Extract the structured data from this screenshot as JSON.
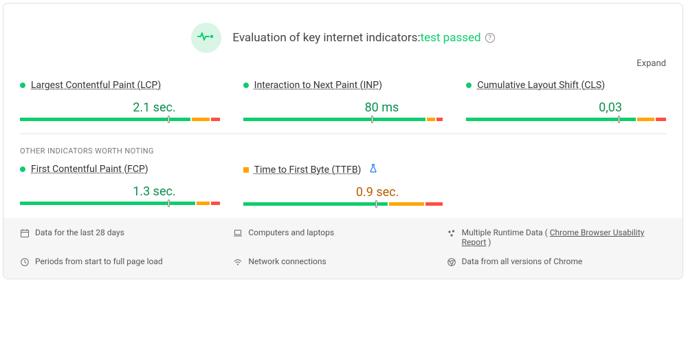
{
  "header": {
    "title_prefix": "Evaluation of key internet indicators:",
    "status_text": "test passed",
    "help_tooltip": "?"
  },
  "controls": {
    "expand_label": "Expand"
  },
  "metrics": {
    "primary": [
      {
        "name": "Largest Contentful Paint (LCP)",
        "value": "2.1 sec.",
        "status": "green",
        "segments": {
          "green": 76,
          "orange": 8,
          "red": 4
        },
        "marker_percent": 74
      },
      {
        "name": "Interaction to Next Paint (INP)",
        "value": "80 ms",
        "status": "green",
        "segments": {
          "green": 86,
          "orange": 4,
          "red": 3
        },
        "marker_percent": 64
      },
      {
        "name": "Cumulative Layout Shift (CLS)",
        "value": "0,03",
        "status": "green",
        "segments": {
          "green": 80,
          "orange": 8,
          "red": 5
        },
        "marker_percent": 76
      }
    ],
    "secondary_heading": "OTHER INDICATORS WORTH NOTING",
    "secondary": [
      {
        "name": "First Contentful Paint (FCP)",
        "value": "1.3 sec.",
        "status": "green",
        "segments": {
          "green": 80,
          "orange": 6,
          "red": 4
        },
        "marker_percent": 74
      },
      {
        "name": "Time to First Byte (TTFB)",
        "value": "0.9 sec.",
        "status": "orange",
        "experimental": true,
        "segments": {
          "green": 66,
          "orange": 16,
          "red": 8
        },
        "marker_percent": 66
      }
    ]
  },
  "footer": {
    "data_period": "Data for the last 28 days",
    "device": "Computers and laptops",
    "runtime_prefix": "Multiple Runtime Data ( ",
    "runtime_link": "Chrome Browser Usability Report",
    "runtime_suffix": " )",
    "periods": "Periods from start to full page load",
    "network": "Network connections",
    "chrome_versions": "Data from all versions of Chrome"
  }
}
